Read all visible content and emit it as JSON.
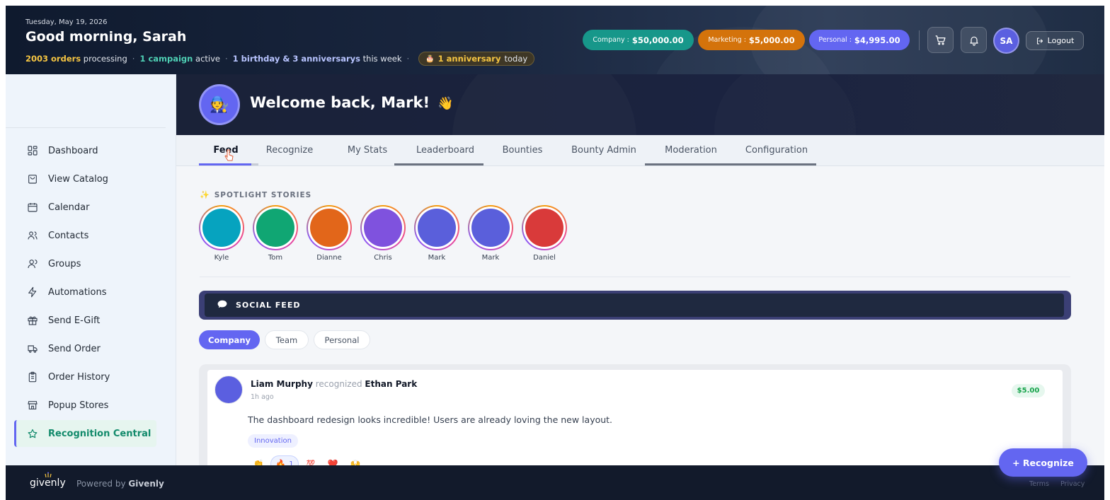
{
  "header": {
    "date": "Tuesday, May 19, 2026",
    "greeting": "Good morning, Sarah",
    "status": {
      "orders_count": "2003 orders",
      "orders_suffix": "processing",
      "campaign_count": "1 campaign",
      "campaign_suffix": "active",
      "events_count": "1 birthday & 3 anniversarys",
      "events_suffix": "this week",
      "anniv_emoji": "🎂",
      "anniv_count": "1 anniversary",
      "anniv_suffix": "today"
    },
    "budgets": {
      "company_label": "Company :",
      "company_value": "$50,000.00",
      "marketing_label": "Marketing :",
      "marketing_value": "$5,000.00",
      "personal_label": "Personal :",
      "personal_value": "$4,995.00"
    },
    "avatar_initials": "SA",
    "logout_label": "Logout"
  },
  "sidebar": {
    "items": [
      {
        "label": "Dashboard",
        "icon": "grid-icon"
      },
      {
        "label": "View Catalog",
        "icon": "bag-icon"
      },
      {
        "label": "Calendar",
        "icon": "calendar-icon"
      },
      {
        "label": "Contacts",
        "icon": "users-icon"
      },
      {
        "label": "Groups",
        "icon": "group-icon"
      },
      {
        "label": "Automations",
        "icon": "bolt-icon"
      },
      {
        "label": "Send E-Gift",
        "icon": "gift-icon"
      },
      {
        "label": "Send Order",
        "icon": "truck-icon"
      },
      {
        "label": "Order History",
        "icon": "clipboard-icon"
      },
      {
        "label": "Popup Stores",
        "icon": "store-icon"
      },
      {
        "label": "Recognition Central",
        "icon": "star-icon",
        "active": true
      }
    ]
  },
  "main": {
    "welcome": "Welcome back, Mark!",
    "welcome_emoji": "👋",
    "avatar_emoji": "🧑‍🔧",
    "tabs": [
      "Feed",
      "Recognize",
      "My Stats",
      "Leaderboard",
      "Bounties",
      "Bounty Admin",
      "Moderation",
      "Configuration"
    ],
    "spotlight_label": "SPOTLIGHT STORIES",
    "stories": [
      {
        "name": "Kyle",
        "color": "#06a3bf"
      },
      {
        "name": "Tom",
        "color": "#10a673"
      },
      {
        "name": "Dianne",
        "color": "#e2661a"
      },
      {
        "name": "Chris",
        "color": "#7f52de"
      },
      {
        "name": "Mark",
        "color": "#5a5fdb"
      },
      {
        "name": "Mark",
        "color": "#5a5fdb"
      },
      {
        "name": "Daniel",
        "color": "#d93a3a"
      }
    ],
    "social_feed_label": "SOCIAL FEED",
    "filters": [
      "Company",
      "Team",
      "Personal"
    ],
    "post": {
      "author": "Liam Murphy",
      "verb": "recognized",
      "recipient": "Ethan Park",
      "time": "1h ago",
      "amount": "$5.00",
      "message": "The dashboard redesign looks incredible! Users are already loving the new layout.",
      "tag": "Innovation",
      "reactions": [
        "👏",
        "🔥",
        "💯",
        "❤️",
        "🙌"
      ],
      "fire_count": "1"
    },
    "fab_label": "+ Recognize"
  },
  "footer": {
    "brand": "givenly",
    "powered_prefix": "Powered by",
    "powered_brand": "Givenly",
    "terms": "Terms",
    "privacy": "Privacy"
  },
  "colors": {
    "accent": "#6366f1",
    "company": "#17978a",
    "marketing": "#d4730b",
    "active_nav_text": "#128a6b"
  }
}
